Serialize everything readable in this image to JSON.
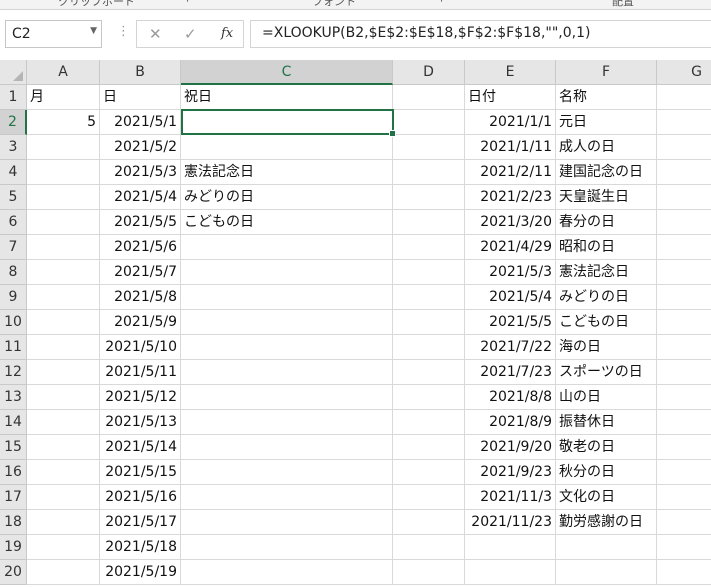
{
  "ribbon_fragments": [
    "クリップボード",
    "⌐",
    "フォント",
    "⌐",
    "配置"
  ],
  "name_box": {
    "value": "C2"
  },
  "formula_bar": {
    "cancel_icon": "✕",
    "enter_icon": "✓",
    "fx_label": "fx",
    "formula": "=XLOOKUP(B2,$E$2:$E$18,$F$2:$F$18,\"\",0,1)"
  },
  "columns": [
    "A",
    "B",
    "C",
    "D",
    "E",
    "F",
    "G"
  ],
  "active_cell": "C2",
  "rows": [
    {
      "num": "1",
      "A": "月",
      "B": "日",
      "C": "祝日",
      "D": "",
      "E": "日付",
      "F": "名称"
    },
    {
      "num": "2",
      "A": "5",
      "B": "2021/5/1",
      "C": "",
      "D": "",
      "E": "2021/1/1",
      "F": "元日"
    },
    {
      "num": "3",
      "A": "",
      "B": "2021/5/2",
      "C": "",
      "D": "",
      "E": "2021/1/11",
      "F": "成人の日"
    },
    {
      "num": "4",
      "A": "",
      "B": "2021/5/3",
      "C": "憲法記念日",
      "D": "",
      "E": "2021/2/11",
      "F": "建国記念の日"
    },
    {
      "num": "5",
      "A": "",
      "B": "2021/5/4",
      "C": "みどりの日",
      "D": "",
      "E": "2021/2/23",
      "F": "天皇誕生日"
    },
    {
      "num": "6",
      "A": "",
      "B": "2021/5/5",
      "C": "こどもの日",
      "D": "",
      "E": "2021/3/20",
      "F": "春分の日"
    },
    {
      "num": "7",
      "A": "",
      "B": "2021/5/6",
      "C": "",
      "D": "",
      "E": "2021/4/29",
      "F": "昭和の日"
    },
    {
      "num": "8",
      "A": "",
      "B": "2021/5/7",
      "C": "",
      "D": "",
      "E": "2021/5/3",
      "F": "憲法記念日"
    },
    {
      "num": "9",
      "A": "",
      "B": "2021/5/8",
      "C": "",
      "D": "",
      "E": "2021/5/4",
      "F": "みどりの日"
    },
    {
      "num": "10",
      "A": "",
      "B": "2021/5/9",
      "C": "",
      "D": "",
      "E": "2021/5/5",
      "F": "こどもの日"
    },
    {
      "num": "11",
      "A": "",
      "B": "2021/5/10",
      "C": "",
      "D": "",
      "E": "2021/7/22",
      "F": "海の日"
    },
    {
      "num": "12",
      "A": "",
      "B": "2021/5/11",
      "C": "",
      "D": "",
      "E": "2021/7/23",
      "F": "スポーツの日"
    },
    {
      "num": "13",
      "A": "",
      "B": "2021/5/12",
      "C": "",
      "D": "",
      "E": "2021/8/8",
      "F": "山の日"
    },
    {
      "num": "14",
      "A": "",
      "B": "2021/5/13",
      "C": "",
      "D": "",
      "E": "2021/8/9",
      "F": "振替休日"
    },
    {
      "num": "15",
      "A": "",
      "B": "2021/5/14",
      "C": "",
      "D": "",
      "E": "2021/9/20",
      "F": "敬老の日"
    },
    {
      "num": "16",
      "A": "",
      "B": "2021/5/15",
      "C": "",
      "D": "",
      "E": "2021/9/23",
      "F": "秋分の日"
    },
    {
      "num": "17",
      "A": "",
      "B": "2021/5/16",
      "C": "",
      "D": "",
      "E": "2021/11/3",
      "F": "文化の日"
    },
    {
      "num": "18",
      "A": "",
      "B": "2021/5/17",
      "C": "",
      "D": "",
      "E": "2021/11/23",
      "F": "勤労感謝の日"
    },
    {
      "num": "19",
      "A": "",
      "B": "2021/5/18",
      "C": "",
      "D": "",
      "E": "",
      "F": ""
    },
    {
      "num": "20",
      "A": "",
      "B": "2021/5/19",
      "C": "",
      "D": "",
      "E": "",
      "F": ""
    }
  ],
  "colors": {
    "accent": "#217346",
    "header_bg": "#e6e6e6",
    "gridline": "#d9d9d9"
  }
}
